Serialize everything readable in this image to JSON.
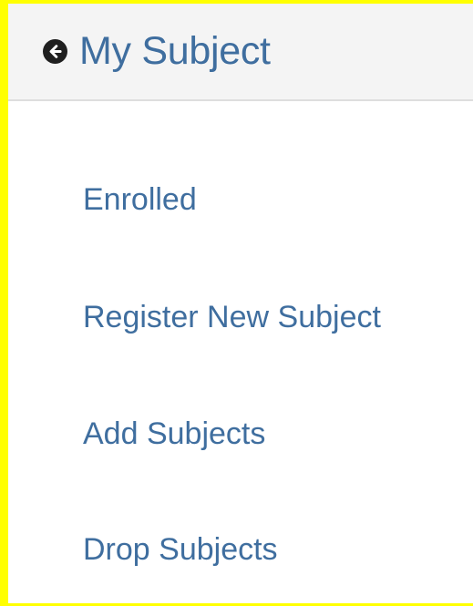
{
  "header": {
    "title": "My Subject",
    "icon": "arrow-circle-left-icon"
  },
  "menu": {
    "items": [
      {
        "label": "Enrolled"
      },
      {
        "label": "Register New Subject"
      },
      {
        "label": "Add Subjects"
      },
      {
        "label": "Drop Subjects"
      }
    ]
  },
  "colors": {
    "accent": "#3f6e9f",
    "header_bg": "#f4f4f4",
    "frame_highlight": "#ffff00"
  }
}
